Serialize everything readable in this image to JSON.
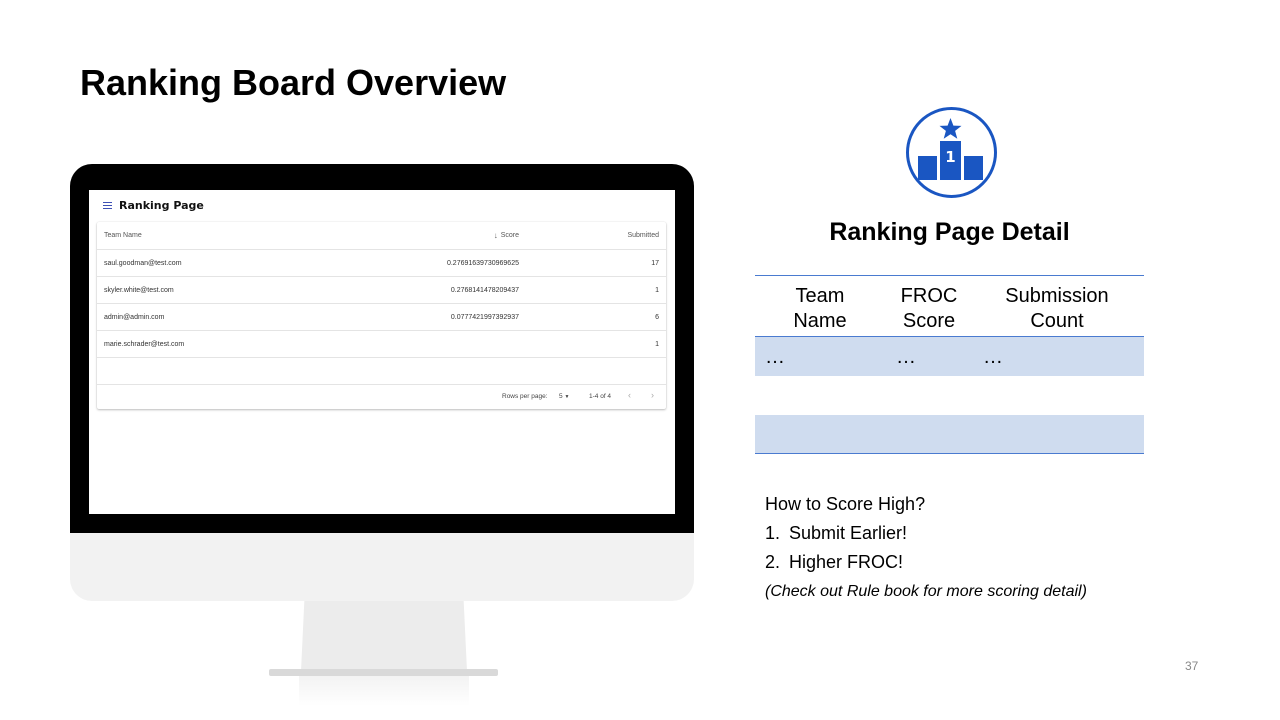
{
  "slide": {
    "title": "Ranking Board Overview",
    "page_number": "37"
  },
  "app": {
    "title": "Ranking Page",
    "table": {
      "headers": {
        "name": "Team Name",
        "score": "Score",
        "submitted": "Submitted"
      },
      "rows": [
        {
          "name": "saul.goodman@test.com",
          "score": "0.27691639730969625",
          "submitted": "17"
        },
        {
          "name": "skyler.white@test.com",
          "score": "0.2768141478209437",
          "submitted": "1"
        },
        {
          "name": "admin@admin.com",
          "score": "0.0777421997392937",
          "submitted": "6"
        },
        {
          "name": "marie.schrader@test.com",
          "score": "",
          "submitted": "1"
        }
      ]
    },
    "pagination": {
      "rows_per_page_label": "Rows per page:",
      "rows_per_page_value": "5",
      "range": "1-4 of 4"
    }
  },
  "detail": {
    "icon": "podium-star-icon",
    "podium_label": "1",
    "title": "Ranking Page Detail",
    "headers": [
      {
        "line1": "Team",
        "line2": "Name"
      },
      {
        "line1": "FROC",
        "line2": "Score"
      },
      {
        "line1": "Submission",
        "line2": "Count"
      }
    ],
    "rows": [
      [
        "…",
        "…",
        "…"
      ]
    ]
  },
  "tips": {
    "heading": "How to Score High?",
    "items": [
      {
        "num": "1.",
        "text": "Submit Earlier!"
      },
      {
        "num": "2.",
        "text": "Higher FROC!"
      }
    ],
    "note": "(Check out Rule book for more scoring detail)"
  },
  "colors": {
    "accent_blue": "#1a56c2",
    "row_shade": "#cfdcef",
    "menu_icon": "#3f51b5"
  }
}
